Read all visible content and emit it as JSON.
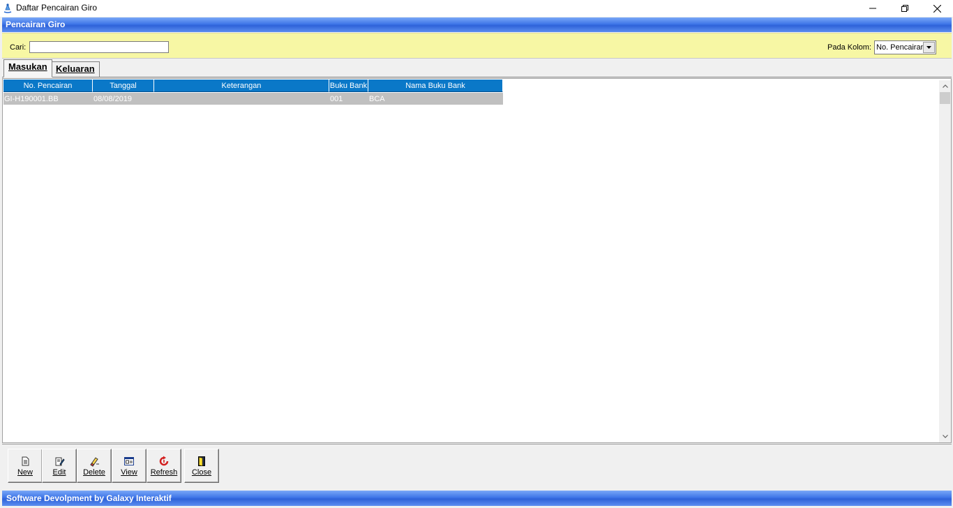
{
  "window": {
    "title": "Daftar Pencairan Giro",
    "header": "Pencairan Giro",
    "icons": {
      "app": "giro-app-icon",
      "minimize": "minimize-icon",
      "maximize": "restore-icon",
      "close": "close-icon"
    }
  },
  "search": {
    "label": "Cari:",
    "value": "",
    "column_label": "Pada Kolom:",
    "column_selected": "No. Pencairan"
  },
  "tabs": [
    {
      "label": "Masukan",
      "active": true
    },
    {
      "label": "Keluaran",
      "active": false
    }
  ],
  "grid": {
    "columns": [
      "No. Pencairan",
      "Tanggal",
      "Keterangan",
      "Buku Bank",
      "Nama Buku Bank"
    ],
    "rows": [
      [
        "GI-H190001.BB",
        "08/08/2019",
        "",
        "001",
        "BCA"
      ]
    ]
  },
  "toolbar": {
    "new": "New",
    "edit": "Edit",
    "delete": "Delete",
    "view": "View",
    "refresh": "Refresh",
    "close": "Close"
  },
  "footer": "Software Devolpment by Galaxy Interaktif",
  "colors": {
    "header_band": "#3f76e8",
    "search_band": "#f7f7a4",
    "grid_header": "#0a78c8",
    "row_selected": "#c0c0c0"
  }
}
